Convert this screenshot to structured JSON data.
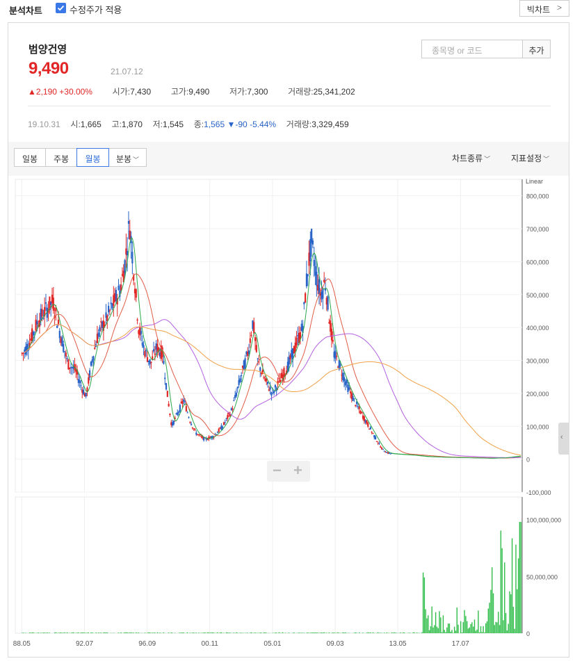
{
  "topbar": {
    "title": "분석차트",
    "adjusted_label": "수정주가 적용",
    "adjusted_checked": true,
    "bigchart_label": "빅차트"
  },
  "stock": {
    "name": "범양건영",
    "price": "9,490",
    "date": "21.07.12",
    "change_amount": "2,190",
    "change_pct": "+30.00%",
    "change_direction": "up",
    "open_label": "시가",
    "open": "7,430",
    "high_label": "고가",
    "high": "9,490",
    "low_label": "저가",
    "low": "7,300",
    "volume_label": "거래량",
    "volume": "25,341,202"
  },
  "search": {
    "placeholder": "종목명 or 코드",
    "add_label": "추가"
  },
  "past": {
    "date": "19.10.31",
    "open_label": "시",
    "open": "1,665",
    "high_label": "고",
    "high": "1,870",
    "low_label": "저",
    "low": "1,545",
    "close_label": "종",
    "close": "1,565",
    "change": "-90",
    "change_pct": "-5.44%",
    "volume_label": "거래량",
    "volume": "3,329,459"
  },
  "tabs": {
    "daily": "일봉",
    "weekly": "주봉",
    "monthly": "월봉",
    "minute": "분봉",
    "active": "monthly"
  },
  "toolbar": {
    "chart_type": "차트종류",
    "indicator": "지표설정"
  },
  "colors": {
    "up": "#e22626",
    "down": "#2863c8",
    "ma5": "#2ba84a",
    "ma20": "#e25b45",
    "ma60": "#b35fe0",
    "ma120": "#f0a045",
    "volume": "#2fbd49"
  },
  "chart_data": {
    "type": "line",
    "scale_label": "Linear",
    "price_axis_ticks": [
      "800,000",
      "700,000",
      "600,000",
      "500,000",
      "400,000",
      "300,000",
      "200,000",
      "100,000",
      "0",
      "-100,000"
    ],
    "price_ylim": [
      -100000,
      850000
    ],
    "volume_axis_ticks": [
      "100,000,000",
      "50,000,000",
      "0"
    ],
    "volume_ylim": [
      0,
      120000000
    ],
    "x_ticks": [
      "88.05",
      "92.07",
      "96.09",
      "00.11",
      "05.01",
      "09.03",
      "13.05",
      "17.07"
    ],
    "price_series": [
      {
        "x": 1988.4,
        "y": 320000
      },
      {
        "x": 1988.9,
        "y": 360000
      },
      {
        "x": 1989.4,
        "y": 420000
      },
      {
        "x": 1989.9,
        "y": 450000
      },
      {
        "x": 1990.4,
        "y": 480000
      },
      {
        "x": 1990.9,
        "y": 380000
      },
      {
        "x": 1991.4,
        "y": 290000
      },
      {
        "x": 1991.9,
        "y": 270000
      },
      {
        "x": 1992.3,
        "y": 220000
      },
      {
        "x": 1992.6,
        "y": 190000
      },
      {
        "x": 1993.0,
        "y": 300000
      },
      {
        "x": 1993.4,
        "y": 380000
      },
      {
        "x": 1993.9,
        "y": 420000
      },
      {
        "x": 1994.4,
        "y": 470000
      },
      {
        "x": 1994.9,
        "y": 520000
      },
      {
        "x": 1995.2,
        "y": 600000
      },
      {
        "x": 1995.5,
        "y": 720000
      },
      {
        "x": 1995.8,
        "y": 560000
      },
      {
        "x": 1996.1,
        "y": 400000
      },
      {
        "x": 1996.5,
        "y": 330000
      },
      {
        "x": 1996.9,
        "y": 290000
      },
      {
        "x": 1997.3,
        "y": 340000
      },
      {
        "x": 1997.7,
        "y": 320000
      },
      {
        "x": 1998.0,
        "y": 200000
      },
      {
        "x": 1998.3,
        "y": 100000
      },
      {
        "x": 1998.7,
        "y": 140000
      },
      {
        "x": 1999.1,
        "y": 180000
      },
      {
        "x": 1999.5,
        "y": 120000
      },
      {
        "x": 1999.9,
        "y": 80000
      },
      {
        "x": 2000.5,
        "y": 60000
      },
      {
        "x": 2001.1,
        "y": 70000
      },
      {
        "x": 2001.7,
        "y": 100000
      },
      {
        "x": 2002.3,
        "y": 150000
      },
      {
        "x": 2002.9,
        "y": 250000
      },
      {
        "x": 2003.4,
        "y": 330000
      },
      {
        "x": 2003.7,
        "y": 420000
      },
      {
        "x": 2004.0,
        "y": 300000
      },
      {
        "x": 2004.5,
        "y": 240000
      },
      {
        "x": 2005.0,
        "y": 200000
      },
      {
        "x": 2005.5,
        "y": 240000
      },
      {
        "x": 2006.0,
        "y": 280000
      },
      {
        "x": 2006.5,
        "y": 340000
      },
      {
        "x": 2007.0,
        "y": 400000
      },
      {
        "x": 2007.3,
        "y": 560000
      },
      {
        "x": 2007.6,
        "y": 660000
      },
      {
        "x": 2007.9,
        "y": 560000
      },
      {
        "x": 2008.2,
        "y": 500000
      },
      {
        "x": 2008.5,
        "y": 540000
      },
      {
        "x": 2008.8,
        "y": 420000
      },
      {
        "x": 2009.1,
        "y": 320000
      },
      {
        "x": 2009.5,
        "y": 280000
      },
      {
        "x": 2009.9,
        "y": 230000
      },
      {
        "x": 2010.4,
        "y": 180000
      },
      {
        "x": 2010.9,
        "y": 140000
      },
      {
        "x": 2011.4,
        "y": 100000
      },
      {
        "x": 2011.9,
        "y": 60000
      },
      {
        "x": 2012.3,
        "y": 30000
      },
      {
        "x": 2012.7,
        "y": 18000
      },
      {
        "x": 2013.5,
        "y": 15000
      },
      {
        "x": 2014.5,
        "y": 12000
      },
      {
        "x": 2015.3,
        "y": 8000
      },
      {
        "x": 2016.5,
        "y": 6000
      },
      {
        "x": 2017.5,
        "y": 5000
      },
      {
        "x": 2018.5,
        "y": 4000
      },
      {
        "x": 2019.5,
        "y": 3000
      },
      {
        "x": 2020.5,
        "y": 4000
      },
      {
        "x": 2021.5,
        "y": 9490
      }
    ]
  }
}
